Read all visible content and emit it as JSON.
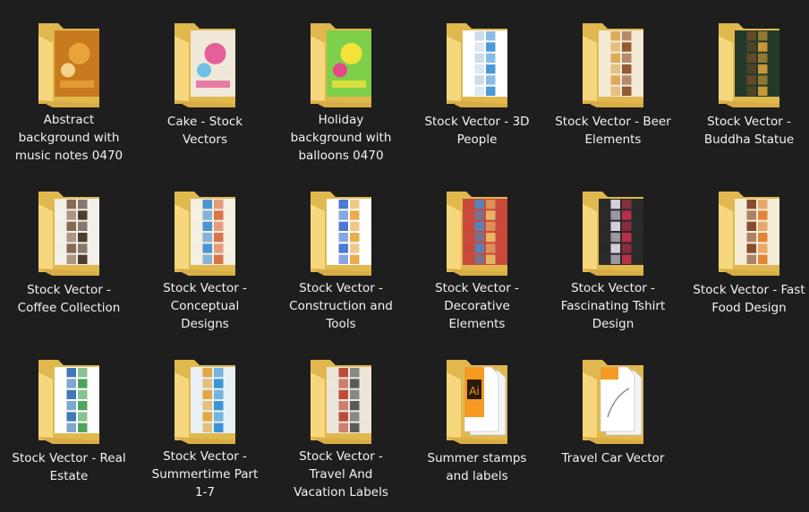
{
  "folders": [
    {
      "label": "Abstract background with music notes 0470",
      "icon": "folder-icon",
      "preview": "art",
      "c": [
        "#c9791e",
        "#e8a43a",
        "#f5d28a"
      ]
    },
    {
      "label": "Cake - Stock Vectors",
      "icon": "folder-icon",
      "preview": "art",
      "c": [
        "#f0e8d8",
        "#e5609a",
        "#6fc2e6"
      ]
    },
    {
      "label": "Holiday background with balloons 0470",
      "icon": "folder-icon",
      "preview": "art",
      "c": [
        "#7ed04a",
        "#f2e23a",
        "#e6488c"
      ]
    },
    {
      "label": "Stock Vector - 3D People",
      "icon": "folder-icon",
      "preview": "grid",
      "c": [
        "#ffffff",
        "#3a8fd6",
        "#c7d8e8"
      ]
    },
    {
      "label": "Stock Vector - Beer Elements",
      "icon": "folder-icon",
      "preview": "grid",
      "c": [
        "#f4ead6",
        "#8a4a22",
        "#d8a44a"
      ]
    },
    {
      "label": "Stock Vector - Buddha Statue",
      "icon": "folder-icon",
      "preview": "grid",
      "c": [
        "#233a2a",
        "#d8a23a",
        "#6a4a2a"
      ]
    },
    {
      "label": "Stock Vector - Coffee Collection",
      "icon": "folder-icon",
      "preview": "grid",
      "c": [
        "#f2efe8",
        "#3a2a1e",
        "#7a5a40"
      ]
    },
    {
      "label": "Stock Vector - Conceptual Designs",
      "icon": "folder-icon",
      "preview": "grid",
      "c": [
        "#f4efe2",
        "#d8663a",
        "#3a8ad0"
      ]
    },
    {
      "label": "Stock Vector - Construction and Tools",
      "icon": "folder-icon",
      "preview": "grid",
      "c": [
        "#ffffff",
        "#e8a33a",
        "#3a6ad0"
      ]
    },
    {
      "label": "Stock Vector - Decorative Elements",
      "icon": "folder-icon",
      "preview": "grid",
      "c": [
        "#c84a3a",
        "#e8c06a",
        "#4a8ac8"
      ]
    },
    {
      "label": "Stock Vector - Fascinating Tshirt Design",
      "icon": "folder-icon",
      "preview": "grid",
      "c": [
        "#2a2a2a",
        "#c8304a",
        "#e8e0f0"
      ]
    },
    {
      "label": "Stock Vector - Fast Food Design",
      "icon": "folder-icon",
      "preview": "grid",
      "c": [
        "#f4ecd6",
        "#e07a24",
        "#7a3a1e"
      ]
    },
    {
      "label": "Stock Vector - Real Estate",
      "icon": "folder-icon",
      "preview": "grid",
      "c": [
        "#ffffff",
        "#3a9a4a",
        "#2a6ab0"
      ]
    },
    {
      "label": "Stock Vector - Summertime Part 1-7",
      "icon": "folder-icon",
      "preview": "grid",
      "c": [
        "#e8f0f6",
        "#2a8ad0",
        "#e0a030"
      ]
    },
    {
      "label": "Stock Vector - Travel And Vacation Labels",
      "icon": "folder-icon",
      "preview": "grid",
      "c": [
        "#ece6da",
        "#4a4a4a",
        "#b83a2a"
      ]
    },
    {
      "label": "Summer stamps and labels",
      "icon": "folder-icon",
      "preview": "ai-file",
      "c": [
        "#2a1a0a",
        "#f59a23",
        "#ffffff"
      ]
    },
    {
      "label": "Travel Car Vector",
      "icon": "folder-icon",
      "preview": "eps-file",
      "c": [
        "#f59a23",
        "#ffffff",
        "#9a9a9a"
      ]
    }
  ]
}
